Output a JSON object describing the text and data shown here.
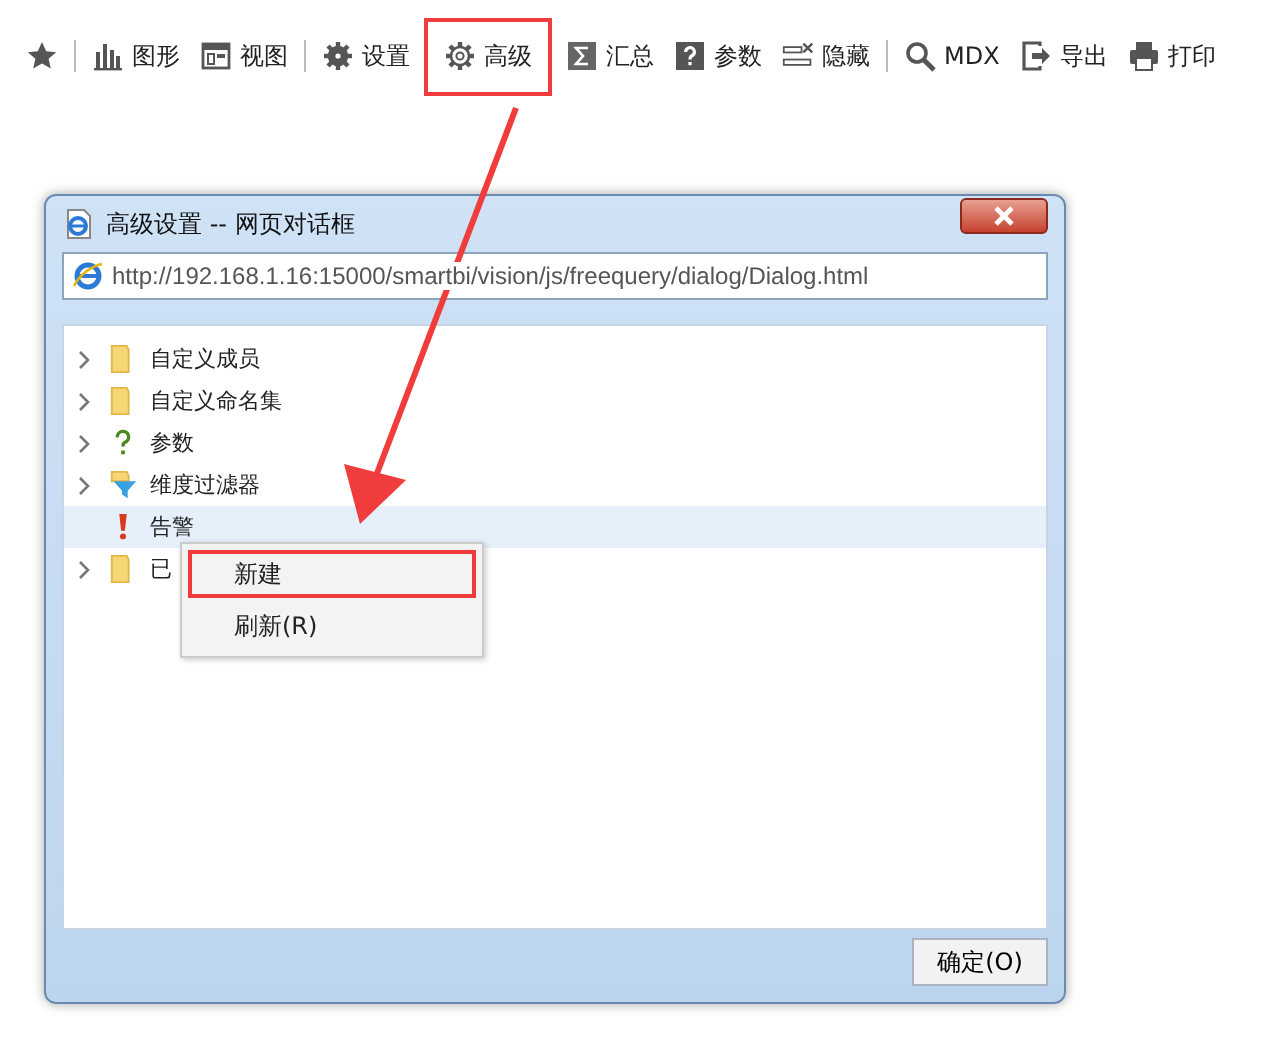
{
  "toolbar": {
    "items": [
      {
        "kind": "star"
      },
      {
        "kind": "separator"
      },
      {
        "kind": "chart",
        "label": "图形"
      },
      {
        "kind": "view",
        "label": "视图"
      },
      {
        "kind": "separator"
      },
      {
        "kind": "gear",
        "label": "设置"
      },
      {
        "kind": "gear-outline",
        "label": "高级",
        "highlighted": true
      },
      {
        "kind": "sigma",
        "label": "汇总"
      },
      {
        "kind": "question",
        "label": "参数"
      },
      {
        "kind": "hide",
        "label": "隐藏"
      },
      {
        "kind": "separator"
      },
      {
        "kind": "search",
        "label": "MDX"
      },
      {
        "kind": "export",
        "label": "导出"
      },
      {
        "kind": "print",
        "label": "打印"
      }
    ]
  },
  "dialog": {
    "title": "高级设置 -- 网页对话框",
    "url": "http://192.168.1.16:15000/smartbi/vision/js/freequery/dialog/Dialog.html",
    "tree": [
      {
        "kind": "folder",
        "label": "自定义成员",
        "expandable": true,
        "selected": false
      },
      {
        "kind": "folder",
        "label": "自定义命名集",
        "expandable": true,
        "selected": false
      },
      {
        "kind": "param",
        "label": "参数",
        "expandable": true,
        "selected": false
      },
      {
        "kind": "filter",
        "label": "维度过滤器",
        "expandable": true,
        "selected": false
      },
      {
        "kind": "alert",
        "label": "告警",
        "expandable": false,
        "selected": true
      },
      {
        "kind": "folder",
        "label": "已",
        "expandable": true,
        "selected": false
      }
    ],
    "context_menu": [
      {
        "label": "新建",
        "highlighted": true
      },
      {
        "label": "刷新(R)",
        "highlighted": false
      }
    ],
    "ok_button": "确定(O)"
  }
}
